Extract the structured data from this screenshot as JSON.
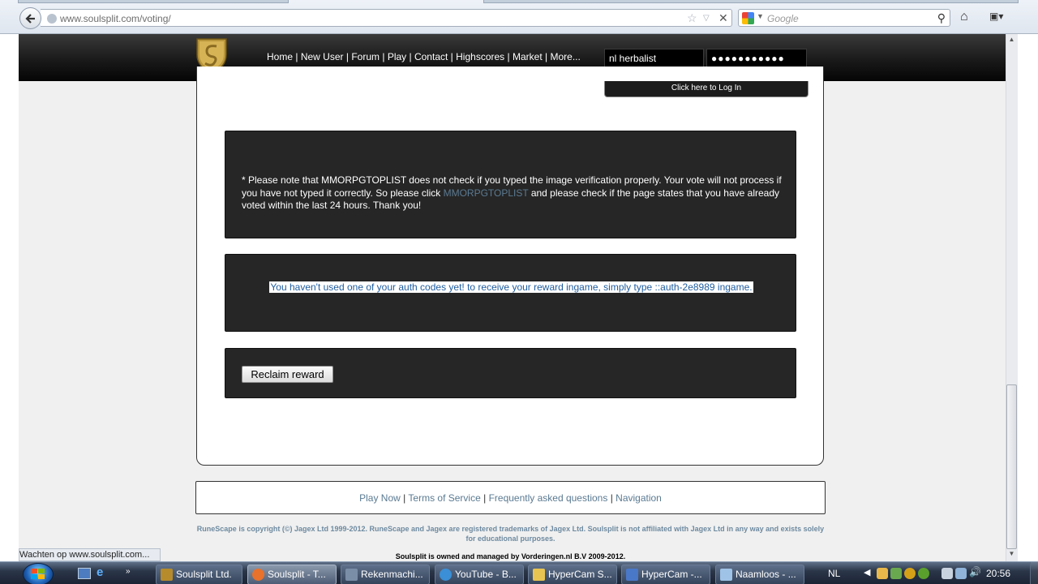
{
  "browser": {
    "url": "www.soulsplit.com/voting/",
    "search_placeholder": "Google",
    "status": "Wachten op www.soulsplit.com..."
  },
  "header": {
    "nav": [
      "Home",
      "New User",
      "Forum",
      "Play",
      "Contact",
      "Highscores",
      "Market",
      "More..."
    ],
    "nav_separator": "|",
    "username_value": "nl herbalist",
    "password_value": "●●●●●●●●●●●",
    "login_label": "Click here to Log In"
  },
  "notice": {
    "text_before": "* Please note that MMORPGTOPLIST does not check if you typed the image verification properly. Your vote will not process if you have not typed it correctly. So please click ",
    "link": "MMORPGTOPLIST",
    "text_after": " and please check if the page states that you have already voted within the last 24 hours. Thank you!"
  },
  "auth": {
    "message": "You haven't used one of your auth codes yet! to receive your reward ingame, simply type ::auth-2e8989 ingame."
  },
  "reclaim": {
    "button_label": "Reclaim reward"
  },
  "footer": {
    "links": [
      "Play Now",
      "Terms of Service",
      "Frequently asked questions",
      "Navigation"
    ],
    "separator": "|",
    "copyright": "RuneScape is copyright (©) Jagex Ltd 1999-2012. RuneScape and Jagex are registered trademarks of Jagex Ltd. Soulsplit is not affiliated with Jagex Ltd in any way and exists solely for educational purposes.",
    "owned_by": "Soulsplit is owned and managed by Vorderingen.nl B.V 2009-2012."
  },
  "taskbar": {
    "buttons": [
      {
        "label": "Soulsplit Ltd.",
        "icon": "soulsplit-icon",
        "color": "#b58b2c"
      },
      {
        "label": "Soulsplit - T...",
        "icon": "firefox-icon",
        "color": "#e8712b"
      },
      {
        "label": "Rekenmachi...",
        "icon": "calculator-icon",
        "color": "#7b8ea8"
      },
      {
        "label": "YouTube - B...",
        "icon": "ie-icon",
        "color": "#3a8fd6"
      },
      {
        "label": "HyperCam S...",
        "icon": "folder-icon",
        "color": "#e8c452"
      },
      {
        "label": "HyperCam -...",
        "icon": "hypercam-icon",
        "color": "#4a78c8"
      },
      {
        "label": "Naamloos - ...",
        "icon": "notepad-icon",
        "color": "#9fc3e6"
      }
    ],
    "language": "NL",
    "time": "20:56"
  },
  "colors": {
    "header_bg": "#1a1a1a",
    "box_bg": "#262626",
    "link": "#5a7a92",
    "auth_text": "#1f5c9f"
  }
}
